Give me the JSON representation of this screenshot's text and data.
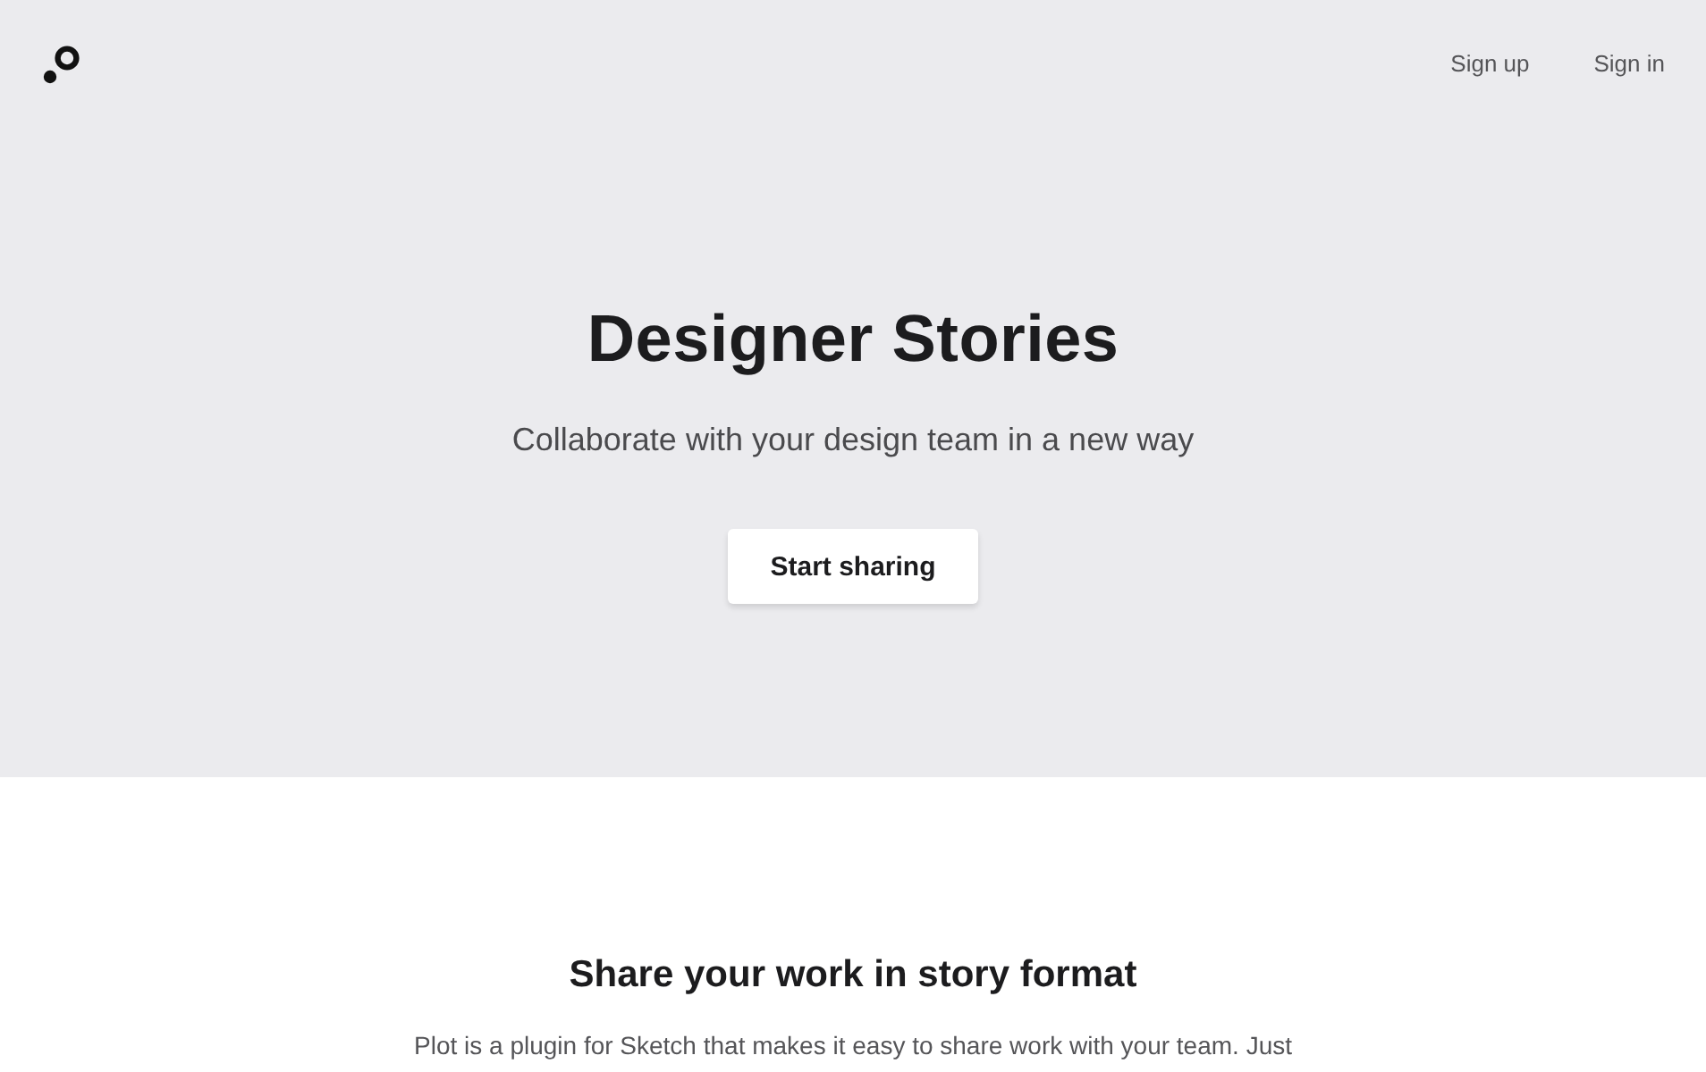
{
  "header": {
    "nav_links": [
      {
        "label": "Sign up"
      },
      {
        "label": "Sign in"
      }
    ]
  },
  "hero": {
    "title": "Designer Stories",
    "subtitle": "Collaborate with your design team in a new way",
    "button": "Start sharing"
  },
  "section": {
    "heading": "Share your work in story format",
    "paragraph": "Plot is a plugin for Sketch that makes it easy to share work with your team. Just"
  }
}
